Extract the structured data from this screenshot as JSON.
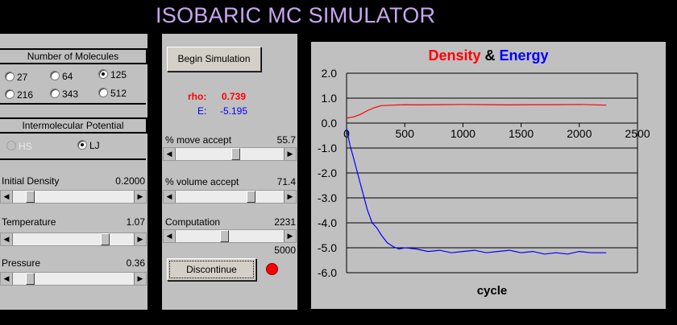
{
  "title": "ISOBARIC MC SIMULATOR",
  "molecules": {
    "header": "Number of Molecules",
    "options": [
      "27",
      "64",
      "125",
      "216",
      "343",
      "512"
    ],
    "selected": "125"
  },
  "potential": {
    "header": "Intermolecular Potential",
    "options": [
      "HS",
      "LJ"
    ],
    "selected": "LJ"
  },
  "params": {
    "density": {
      "label": "Initial Density",
      "value": "0.2000",
      "level": 0.12
    },
    "temperature": {
      "label": "Temperature",
      "value": "1.07",
      "level": 0.78
    },
    "pressure": {
      "label": "Pressure",
      "value": "0.36",
      "level": 0.12
    }
  },
  "controls": {
    "begin_label": "Begin Simulation",
    "rho_label": "rho:",
    "rho_value": "0.739",
    "e_label": "E:",
    "e_value": "-5.195",
    "move": {
      "label": "% move accept",
      "value": "55.7",
      "level": 0.56
    },
    "volume": {
      "label": "% volume accept",
      "value": "71.4",
      "level": 0.71
    },
    "computation": {
      "label": "Computation",
      "value": "2231",
      "max": "5000",
      "level": 0.45
    },
    "discontinue_label": "Discontinue",
    "led_color": "#ff0000"
  },
  "chart_data": {
    "type": "line",
    "title_parts": [
      {
        "text": "Density",
        "color": "#ff0000"
      },
      {
        "text": " & ",
        "color": "#000000"
      },
      {
        "text": "Energy",
        "color": "#0000ff"
      }
    ],
    "xlabel": "cycle",
    "xlim": [
      0,
      2500
    ],
    "ylim": [
      -6.0,
      2.0
    ],
    "xticks": [
      0,
      500,
      1000,
      1500,
      2000,
      2500
    ],
    "yticks": [
      2.0,
      1.0,
      0.0,
      -1.0,
      -2.0,
      -3.0,
      -4.0,
      -5.0,
      -6.0
    ],
    "ytick_labels": [
      "2.0",
      "1.0",
      "0.0",
      "-1.0",
      "-2.0",
      "-3.0",
      "-4.0",
      "-5.0",
      "-6.0"
    ],
    "grid": "horizontal",
    "series": [
      {
        "color": "#ff0000",
        "x": [
          0,
          60,
          120,
          180,
          240,
          300,
          400,
          500,
          600,
          800,
          1000,
          1200,
          1400,
          1600,
          1800,
          2000,
          2231
        ],
        "y": [
          0.2,
          0.25,
          0.35,
          0.5,
          0.62,
          0.7,
          0.72,
          0.74,
          0.73,
          0.74,
          0.75,
          0.74,
          0.73,
          0.74,
          0.74,
          0.75,
          0.72
        ]
      },
      {
        "color": "#0000ff",
        "x": [
          0,
          30,
          60,
          100,
          140,
          180,
          220,
          260,
          300,
          350,
          400,
          450,
          500,
          600,
          700,
          800,
          900,
          1000,
          1100,
          1200,
          1300,
          1400,
          1500,
          1600,
          1700,
          1800,
          1900,
          2000,
          2100,
          2231
        ],
        "y": [
          -0.2,
          -0.9,
          -1.4,
          -2.1,
          -2.8,
          -3.5,
          -4.0,
          -4.2,
          -4.5,
          -4.8,
          -4.95,
          -5.05,
          -5.0,
          -5.05,
          -5.15,
          -5.1,
          -5.2,
          -5.15,
          -5.1,
          -5.2,
          -5.15,
          -5.1,
          -5.2,
          -5.15,
          -5.25,
          -5.2,
          -5.25,
          -5.15,
          -5.2,
          -5.2
        ]
      }
    ]
  }
}
